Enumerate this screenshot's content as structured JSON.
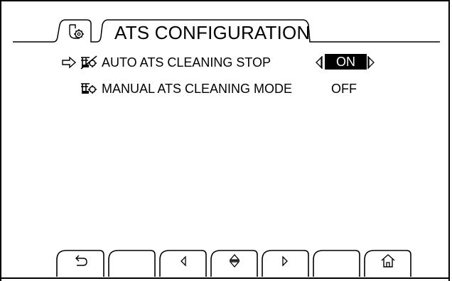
{
  "header": {
    "tab_icon": "gear-config-icon",
    "title": "ATS CONFIGURATION"
  },
  "rows": [
    {
      "selected": true,
      "icon": "ats-cleaning-stop-icon",
      "label": "AUTO ATS CLEANING STOP",
      "value": "ON",
      "editable": true
    },
    {
      "selected": false,
      "icon": "ats-cleaning-mode-icon",
      "label": "MANUAL ATS CLEANING MODE",
      "value": "OFF",
      "editable": false
    }
  ],
  "softkeys": [
    {
      "icon": "back-icon"
    },
    {
      "icon": ""
    },
    {
      "icon": "left-arrow-icon"
    },
    {
      "icon": "up-down-arrow-icon"
    },
    {
      "icon": "right-arrow-icon"
    },
    {
      "icon": ""
    },
    {
      "icon": "home-icon"
    }
  ]
}
